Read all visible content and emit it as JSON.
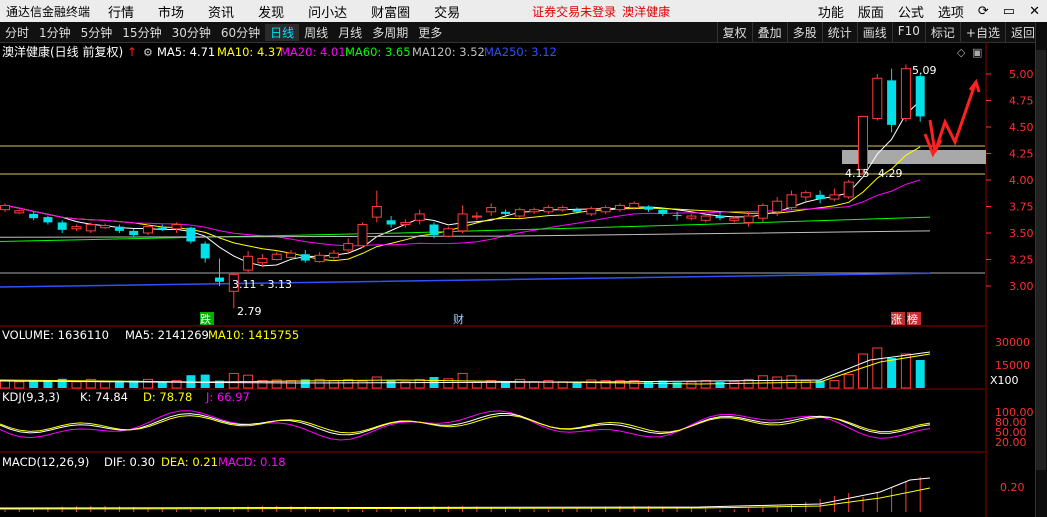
{
  "window": {
    "title": "通达信金融终端",
    "menu": [
      "行情",
      "市场",
      "资讯",
      "发现",
      "问小达",
      "财富圈",
      "交易"
    ],
    "warning": "证券交易未登录",
    "stock_name_top": "澳洋健康",
    "right_menu": [
      "功能",
      "版面",
      "公式",
      "选项"
    ]
  },
  "toolbar": {
    "periods": [
      "分时",
      "1分钟",
      "5分钟",
      "15分钟",
      "30分钟",
      "60分钟",
      "日线",
      "周线",
      "月线",
      "多周期",
      "更多"
    ],
    "active": "日线",
    "right_buttons": [
      "复权",
      "叠加",
      "多股",
      "统计",
      "画线",
      "F10",
      "标记",
      "+自选",
      "返回"
    ]
  },
  "price_panel": {
    "title": "澳洋健康(日线 前复权)",
    "ma": [
      {
        "label": "MA5: 4.71",
        "color": "#ffffff"
      },
      {
        "label": "MA10: 4.37",
        "color": "#ffff00"
      },
      {
        "label": "MA20: 4.01",
        "color": "#ff00ff"
      },
      {
        "label": "MA60: 3.65",
        "color": "#00ff00"
      },
      {
        "label": "MA120: 3.52",
        "color": "#c0c0c0"
      },
      {
        "label": "MA250: 3.12",
        "color": "#3050ff"
      }
    ],
    "y_ticks": [
      "5.00",
      "4.75",
      "4.50",
      "4.25",
      "4.00",
      "3.75",
      "3.50",
      "3.25",
      "3.00"
    ],
    "annotations": {
      "high": "5.09",
      "low": "2.79",
      "range": "3.11 - 3.13",
      "level1": "4.15",
      "level2": "4.29",
      "marker_left": "跌",
      "marker_mid": "财",
      "marker_right1": "涨",
      "marker_right2": "榜"
    }
  },
  "volume_panel": {
    "title": "VOLUME: 1636110",
    "ma5": "MA5: 2141269",
    "ma10": "MA10: 1415755",
    "y_ticks": [
      "30000",
      "15000"
    ],
    "unit": "X100"
  },
  "kdj_panel": {
    "title": "KDJ(9,3,3)",
    "k": "K: 74.84",
    "d": "D: 78.78",
    "j": "J: 66.97",
    "y_ticks": [
      "100.00",
      "80.00",
      "50.00",
      "20.00"
    ]
  },
  "macd_panel": {
    "title": "MACD(12,26,9)",
    "dif": "DIF: 0.30",
    "dea": "DEA: 0.21",
    "macd": "MACD: 0.18",
    "y_ticks": [
      "0.20"
    ]
  },
  "chart_data": {
    "type": "candlestick",
    "candles": [
      [
        3.7,
        3.78,
        3.72,
        3.76
      ],
      [
        3.68,
        3.72,
        3.69,
        3.71
      ],
      [
        3.62,
        3.7,
        3.68,
        3.64
      ],
      [
        3.58,
        3.66,
        3.65,
        3.6
      ],
      [
        3.5,
        3.62,
        3.6,
        3.53
      ],
      [
        3.52,
        3.58,
        3.54,
        3.56
      ],
      [
        3.5,
        3.6,
        3.52,
        3.58
      ],
      [
        3.54,
        3.59,
        3.55,
        3.57
      ],
      [
        3.5,
        3.58,
        3.56,
        3.52
      ],
      [
        3.46,
        3.54,
        3.52,
        3.48
      ],
      [
        3.48,
        3.58,
        3.5,
        3.56
      ],
      [
        3.52,
        3.58,
        3.55,
        3.53
      ],
      [
        3.5,
        3.6,
        3.54,
        3.58
      ],
      [
        3.4,
        3.56,
        3.55,
        3.42
      ],
      [
        3.22,
        3.42,
        3.4,
        3.26
      ],
      [
        3.0,
        3.26,
        3.08,
        3.04
      ],
      [
        2.79,
        3.13,
        2.95,
        3.11
      ],
      [
        3.12,
        3.33,
        3.15,
        3.28
      ],
      [
        3.18,
        3.3,
        3.22,
        3.26
      ],
      [
        3.24,
        3.32,
        3.25,
        3.3
      ],
      [
        3.26,
        3.34,
        3.27,
        3.31
      ],
      [
        3.22,
        3.34,
        3.3,
        3.24
      ],
      [
        3.22,
        3.32,
        3.23,
        3.29
      ],
      [
        3.24,
        3.34,
        3.27,
        3.31
      ],
      [
        3.3,
        3.45,
        3.34,
        3.4
      ],
      [
        3.36,
        3.6,
        3.38,
        3.58
      ],
      [
        3.6,
        3.9,
        3.65,
        3.75
      ],
      [
        3.55,
        3.66,
        3.62,
        3.58
      ],
      [
        3.55,
        3.63,
        3.58,
        3.6
      ],
      [
        3.58,
        3.72,
        3.62,
        3.68
      ],
      [
        3.45,
        3.6,
        3.58,
        3.48
      ],
      [
        3.46,
        3.56,
        3.47,
        3.54
      ],
      [
        3.5,
        3.76,
        3.52,
        3.68
      ],
      [
        3.62,
        3.7,
        3.65,
        3.66
      ],
      [
        3.66,
        3.78,
        3.7,
        3.74
      ],
      [
        3.66,
        3.72,
        3.7,
        3.68
      ],
      [
        3.64,
        3.74,
        3.66,
        3.72
      ],
      [
        3.68,
        3.74,
        3.7,
        3.72
      ],
      [
        3.68,
        3.76,
        3.7,
        3.74
      ],
      [
        3.7,
        3.76,
        3.72,
        3.74
      ],
      [
        3.68,
        3.74,
        3.72,
        3.7
      ],
      [
        3.66,
        3.75,
        3.68,
        3.73
      ],
      [
        3.68,
        3.76,
        3.7,
        3.74
      ],
      [
        3.7,
        3.78,
        3.72,
        3.76
      ],
      [
        3.72,
        3.8,
        3.74,
        3.78
      ],
      [
        3.7,
        3.76,
        3.75,
        3.72
      ],
      [
        3.66,
        3.74,
        3.72,
        3.68
      ],
      [
        3.62,
        3.7,
        3.67,
        3.66
      ],
      [
        3.62,
        3.68,
        3.64,
        3.66
      ],
      [
        3.6,
        3.68,
        3.62,
        3.66
      ],
      [
        3.62,
        3.7,
        3.66,
        3.64
      ],
      [
        3.6,
        3.66,
        3.62,
        3.64
      ],
      [
        3.56,
        3.7,
        3.6,
        3.66
      ],
      [
        3.6,
        3.78,
        3.64,
        3.76
      ],
      [
        3.66,
        3.84,
        3.7,
        3.8
      ],
      [
        3.72,
        3.9,
        3.74,
        3.86
      ],
      [
        3.8,
        3.9,
        3.84,
        3.88
      ],
      [
        3.78,
        3.9,
        3.86,
        3.82
      ],
      [
        3.8,
        3.92,
        3.82,
        3.86
      ],
      [
        3.82,
        4.0,
        3.84,
        3.98
      ],
      [
        4.05,
        4.6,
        4.1,
        4.6
      ],
      [
        4.56,
        5.0,
        4.58,
        4.96
      ],
      [
        4.45,
        5.05,
        4.94,
        4.52
      ],
      [
        4.55,
        5.09,
        4.58,
        5.05
      ],
      [
        4.55,
        5.0,
        4.98,
        4.6
      ]
    ]
  }
}
